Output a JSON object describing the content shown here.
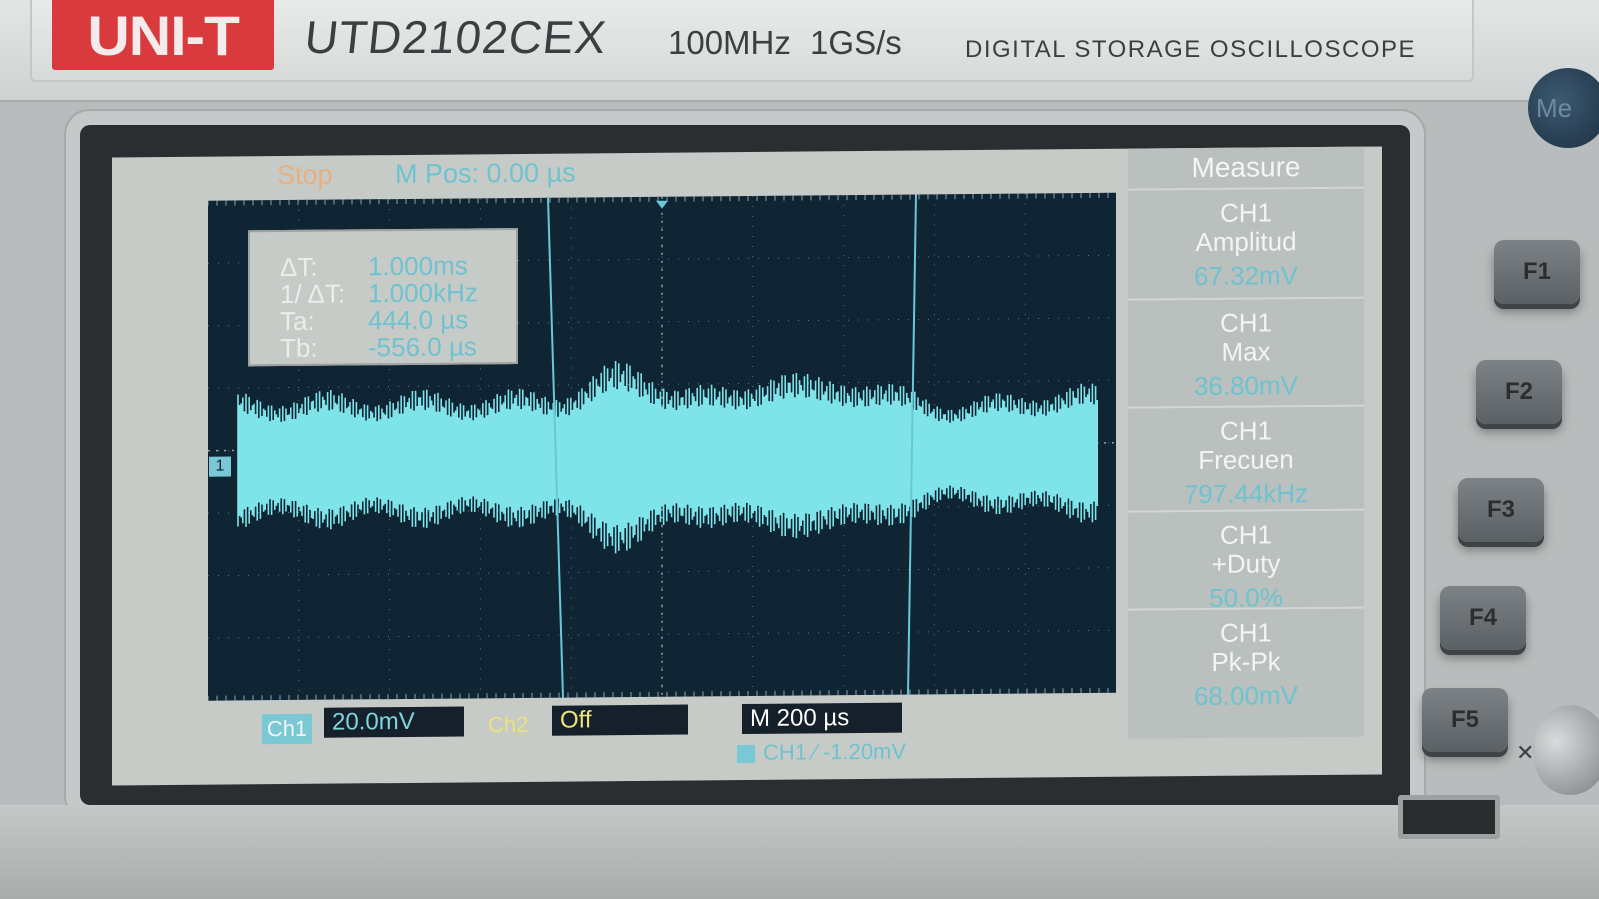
{
  "brand": {
    "logo": "UNI-T",
    "model": "UTD2102CEX",
    "spec": "100MHz 1GS/s",
    "description": "DIGITAL STORAGE OSCILLOSCOPE"
  },
  "screen": {
    "run_state": "Stop",
    "m_pos": "M Pos: 0.00 µs",
    "cursors": {
      "delta_t_label": "ΔT:",
      "delta_t_value": "1.000ms",
      "inv_delta_t_label": "1/ ΔT:",
      "inv_delta_t_value": "1.000kHz",
      "ta_label": "Ta:",
      "ta_value": "444.0 µs",
      "tb_label": "Tb:",
      "tb_value": "-556.0 µs"
    },
    "channel_marker": "1",
    "measure": {
      "title": "Measure",
      "items": [
        {
          "channel": "CH1",
          "name": "Amplitud",
          "value": "67.32mV"
        },
        {
          "channel": "CH1",
          "name": "Max",
          "value": "36.80mV"
        },
        {
          "channel": "CH1",
          "name": "Frecuen",
          "value": "797.44kHz"
        },
        {
          "channel": "CH1",
          "name": "+Duty",
          "value": "50.0%"
        },
        {
          "channel": "CH1",
          "name": "Pk-Pk",
          "value": "68.00mV"
        }
      ]
    },
    "status": {
      "ch1_label": "Ch1",
      "ch1_scale": "20.0mV",
      "ch2_label": "Ch2",
      "ch2_state": "Off",
      "timebase": "M 200 µs",
      "trigger": "CH1 ∕ -1.20mV"
    },
    "colors": {
      "trace": "#7fe3ea",
      "cursor": "#66c8d8",
      "grid_bg": "#0f2534"
    }
  },
  "panel_keys": [
    "F1",
    "F2",
    "F3",
    "F4",
    "F5"
  ],
  "power_label": "Me"
}
